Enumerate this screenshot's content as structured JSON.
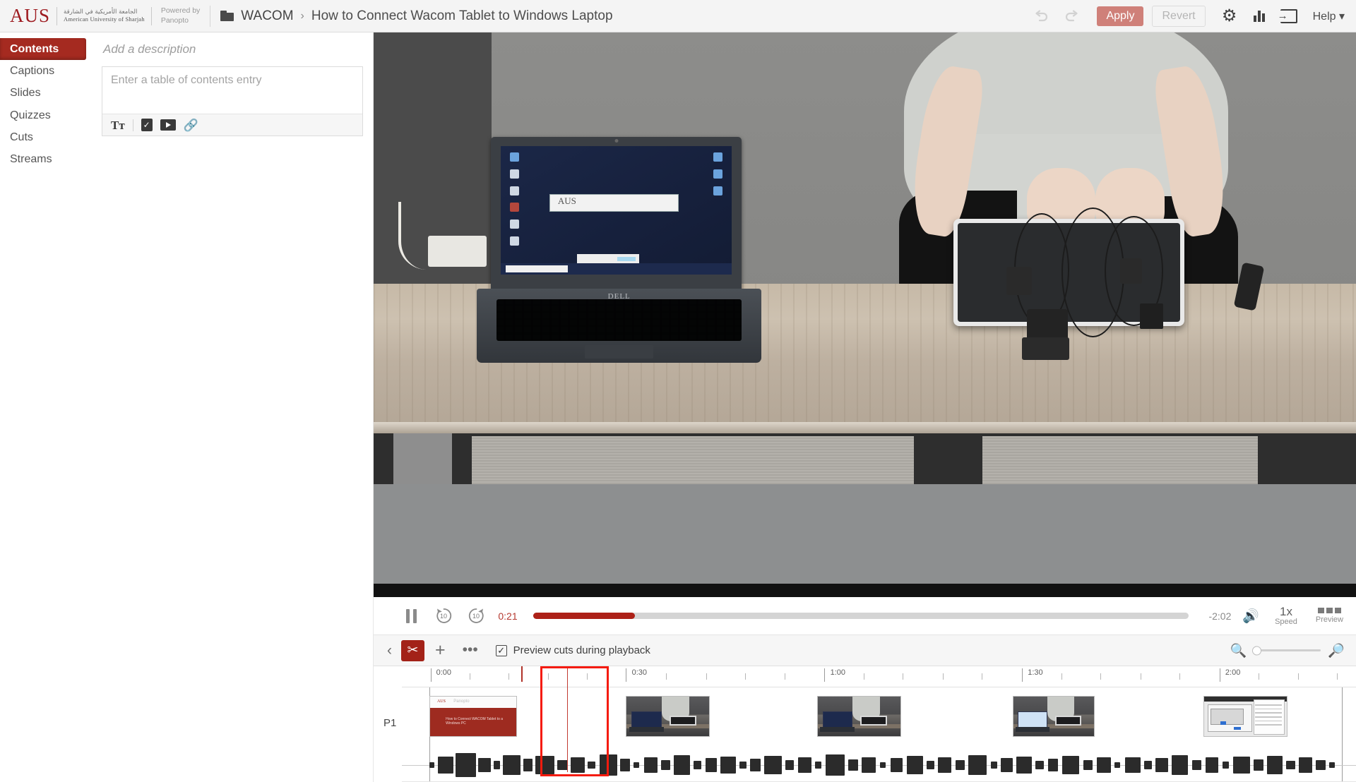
{
  "header": {
    "logo_text": "AUS",
    "logo_arabic": "الجامعة الأمريكية في الشارقة",
    "logo_english": "American University of Sharjah",
    "powered_by": "Powered by\nPanopto",
    "powered_line1": "Powered by",
    "powered_line2": "Panopto",
    "breadcrumb_folder": "WACOM",
    "breadcrumb_sep": "›",
    "breadcrumb_title": "How to Connect Wacom Tablet to Windows Laptop",
    "undo_label": "Undo",
    "redo_label": "Redo",
    "apply_label": "Apply",
    "revert_label": "Revert",
    "settings_label": "Settings",
    "stats_label": "Statistics",
    "share_label": "Share",
    "help_label": "Help ▾",
    "accent_color": "#a32218",
    "apply_color": "#cf8079"
  },
  "sidebar": {
    "items": [
      {
        "label": "Contents",
        "active": true
      },
      {
        "label": "Captions",
        "active": false
      },
      {
        "label": "Slides",
        "active": false
      },
      {
        "label": "Quizzes",
        "active": false
      },
      {
        "label": "Cuts",
        "active": false
      },
      {
        "label": "Streams",
        "active": false
      }
    ]
  },
  "editor": {
    "description_placeholder": "Add a description",
    "toc_placeholder": "Enter a table of contents entry",
    "toolbar": {
      "text_label": "Tт",
      "quiz_label": "Add quiz",
      "video_label": "Add video",
      "link_label": "Add link"
    }
  },
  "player": {
    "pause_label": "Pause",
    "rewind_label": "10",
    "forward_label": "10",
    "current_time": "0:21",
    "remaining_time": "-2:02",
    "progress_percent": 15.5,
    "volume_label": "Volume",
    "speed_value": "1x",
    "speed_label": "Speed",
    "preview_label": "Preview"
  },
  "timeline_toolbar": {
    "back_label": "‹",
    "cut_label": "Cut",
    "add_label": "+",
    "more_label": "•••",
    "checkbox_label": "Preview cuts during playback",
    "checkbox_checked": true,
    "zoom_out_label": "Zoom out",
    "zoom_in_label": "Zoom in",
    "zoom_value": 0
  },
  "timeline": {
    "track_label": "P1",
    "ruler_labels": [
      "0:00",
      "0:30",
      "1:00",
      "1:30",
      "2:00"
    ],
    "ruler_positions_pct": [
      3.0,
      23.5,
      44.3,
      65.0,
      85.7
    ],
    "minor_tick_count": 5,
    "selection": {
      "left_pct": 14.5,
      "width_pct": 7.2
    },
    "playhead_pct": 17.3,
    "cut_marker_pct": 12.5,
    "thumbnails": [
      {
        "type": "title",
        "left_pct": 2.4,
        "width_pct": 9.2,
        "aus": "AUS",
        "panopto": "Panopto",
        "caption": "How to Connect WACOM Tablet to a Windows PC"
      },
      {
        "type": "photo",
        "left_pct": 23.5,
        "width_pct": 8.8
      },
      {
        "type": "photo",
        "left_pct": 43.5,
        "width_pct": 8.8
      },
      {
        "type": "photo",
        "left_pct": 64.0,
        "width_pct": 8.6
      },
      {
        "type": "screen",
        "left_pct": 84.0,
        "width_pct": 8.8
      }
    ]
  },
  "video": {
    "scene_description": "Person in grey shirt holding cables above a Wacom tablet next to a Dell laptop on a wooden desk",
    "laptop_brand": "DELL",
    "laptop_dialog_text": "AUS"
  }
}
